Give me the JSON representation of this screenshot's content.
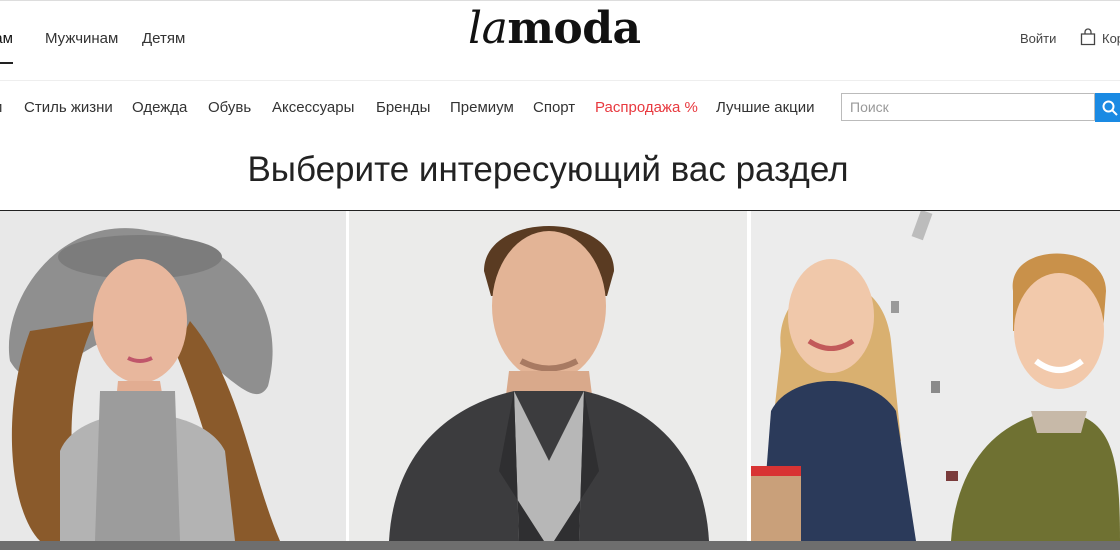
{
  "header": {
    "gender_tabs": [
      {
        "label": "нам"
      },
      {
        "label": "Мужчинам"
      },
      {
        "label": "Детям"
      }
    ],
    "logo": {
      "part1": "la",
      "part2": "moda"
    },
    "login_label": "Войти",
    "cart_label": "Кор"
  },
  "nav": {
    "items": [
      {
        "label": "и"
      },
      {
        "label": "Стиль жизни"
      },
      {
        "label": "Одежда"
      },
      {
        "label": "Обувь"
      },
      {
        "label": "Аксессуары"
      },
      {
        "label": "Бренды"
      },
      {
        "label": "Премиум"
      },
      {
        "label": "Спорт"
      },
      {
        "label": "Распродажа %"
      },
      {
        "label": "Лучшие акции"
      }
    ],
    "search": {
      "placeholder": "Поиск"
    }
  },
  "main": {
    "heading": "Выберите интересующий вас раздел",
    "tiles": [
      {
        "icon": "women-section-photo"
      },
      {
        "icon": "men-section-photo"
      },
      {
        "icon": "kids-section-photo"
      }
    ]
  },
  "colors": {
    "accent": "#1a8ae3",
    "sale": "#e8393f",
    "text": "#222222"
  }
}
